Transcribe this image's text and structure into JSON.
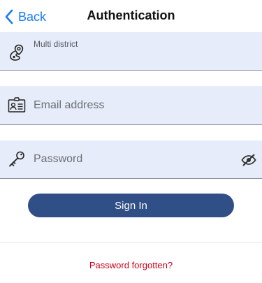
{
  "navbar": {
    "back_label": "Back",
    "title": "Authentication"
  },
  "district_field": {
    "label": "Multi district"
  },
  "email_field": {
    "placeholder": "Email address",
    "value": ""
  },
  "password_field": {
    "placeholder": "Password",
    "value": ""
  },
  "actions": {
    "sign_in_label": "Sign In",
    "forgot_label": "Password forgotten?"
  },
  "icons": {
    "back": "chevron-left-icon",
    "district": "map-pin-route-icon",
    "email": "id-card-icon",
    "password": "key-icon",
    "visibility": "eye-off-icon"
  },
  "colors": {
    "accent": "#1a7cf2",
    "field_background": "#e6ecf9",
    "primary_button": "#2f4f86",
    "link_error": "#d0021b"
  }
}
